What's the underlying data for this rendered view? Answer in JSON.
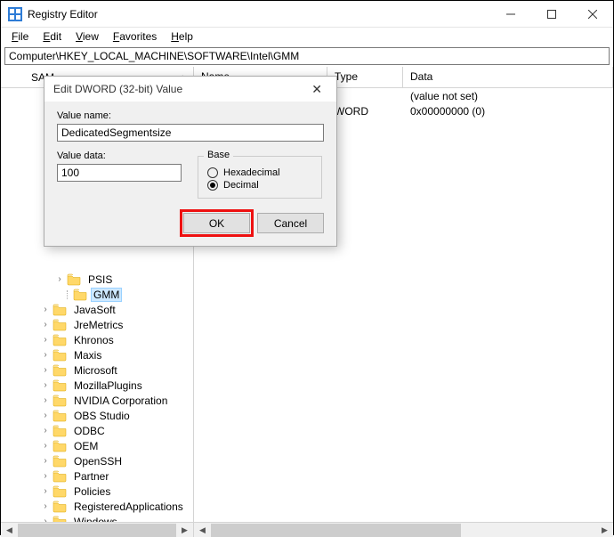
{
  "window": {
    "title": "Registry Editor"
  },
  "menu": {
    "file": "File",
    "edit": "Edit",
    "view": "View",
    "favorites": "Favorites",
    "help": "Help"
  },
  "address": "Computer\\HKEY_LOCAL_MACHINE\\SOFTWARE\\Intel\\GMM",
  "tree": {
    "header": "SAM",
    "items": [
      {
        "indent": 4,
        "exp": "closed",
        "label": "PSIS"
      },
      {
        "indent": 4,
        "exp": "none",
        "label": "GMM",
        "selected": true
      },
      {
        "indent": 3,
        "exp": "closed",
        "label": "JavaSoft"
      },
      {
        "indent": 3,
        "exp": "closed",
        "label": "JreMetrics"
      },
      {
        "indent": 3,
        "exp": "closed",
        "label": "Khronos"
      },
      {
        "indent": 3,
        "exp": "closed",
        "label": "Maxis"
      },
      {
        "indent": 3,
        "exp": "closed",
        "label": "Microsoft"
      },
      {
        "indent": 3,
        "exp": "closed",
        "label": "MozillaPlugins"
      },
      {
        "indent": 3,
        "exp": "closed",
        "label": "NVIDIA Corporation"
      },
      {
        "indent": 3,
        "exp": "closed",
        "label": "OBS Studio"
      },
      {
        "indent": 3,
        "exp": "closed",
        "label": "ODBC"
      },
      {
        "indent": 3,
        "exp": "closed",
        "label": "OEM"
      },
      {
        "indent": 3,
        "exp": "closed",
        "label": "OpenSSH"
      },
      {
        "indent": 3,
        "exp": "closed",
        "label": "Partner"
      },
      {
        "indent": 3,
        "exp": "closed",
        "label": "Policies"
      },
      {
        "indent": 3,
        "exp": "closed",
        "label": "RegisteredApplications"
      },
      {
        "indent": 3,
        "exp": "closed",
        "label": "Windows"
      }
    ]
  },
  "list": {
    "cols": {
      "name": "Name",
      "type": "Type",
      "data": "Data"
    },
    "rows": [
      {
        "name": "",
        "type": "",
        "data": "(value not set)"
      },
      {
        "name": "",
        "type": "WORD",
        "data": "0x00000000 (0)"
      }
    ]
  },
  "dialog": {
    "title": "Edit DWORD (32-bit) Value",
    "value_name_label": "Value name:",
    "value_name": "DedicatedSegmentsize",
    "value_data_label": "Value data:",
    "value_data": "100",
    "base_label": "Base",
    "hex_label": "Hexadecimal",
    "dec_label": "Decimal",
    "ok": "OK",
    "cancel": "Cancel"
  }
}
